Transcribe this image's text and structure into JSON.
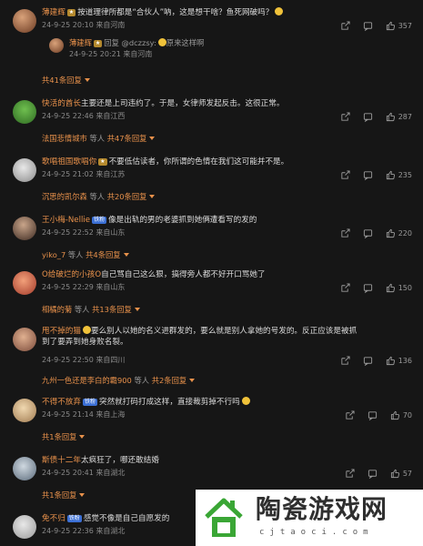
{
  "comments": [
    {
      "user": "薄建辉",
      "badge": "",
      "text": "按道理律所都是“合伙人”吶，这是想干啥？鱼死网破吗？",
      "time": "24-9-25 20:10",
      "location": "来自河南",
      "likes": "357",
      "reply": {
        "user": "薄建辉",
        "text": "回复 @dczzsy:",
        "text2": "原来这样啊",
        "time": "24-9-25 20:21",
        "location": "来自河南"
      },
      "more": "共41条回复"
    },
    {
      "user": "快活的酋长",
      "text": "主要还是上司违约了。于是，女律师发起反击。这很正常。",
      "time": "24-9-25 22:46",
      "location": "来自江西",
      "likes": "287",
      "sub_user": "法国悲情城市",
      "sub_mid": "等人",
      "more": "共47条回复"
    },
    {
      "user": "歌唱祖国歌唱你",
      "badge": "",
      "text": "不要低估读者，你所谓的色情在我们这可能并不是。",
      "time": "24-9-25 21:02",
      "location": "来自江苏",
      "likes": "235",
      "sub_user": "沉思的凯尔森",
      "sub_mid": "等人",
      "more": "共20条回复"
    },
    {
      "user": "王小梅-Nellie",
      "badge": "铁粉",
      "text": "像是出轨的男的老婆抓到她俩遭看写的发的",
      "time": "24-9-25 22:52",
      "location": "来自山东",
      "likes": "220",
      "sub_user": "yiko_7",
      "sub_mid": "等人",
      "more": "共4条回复"
    },
    {
      "user": "O给破烂的小孩O",
      "text": "自己骂自己这么狠，搞得旁人都不好开口骂她了",
      "time": "24-9-25 22:29",
      "location": "来自山东",
      "likes": "150",
      "sub_user": "相橘的菊",
      "sub_mid": "等人",
      "more": "共13条回复"
    },
    {
      "user": "甩不掉的猫",
      "text": "要么别人以她的名义进群发的，要么就是别人拿她的号发的。反正应该是被抓到了要弄到她身败名裂。",
      "time": "24-9-25 22:50",
      "location": "来自四川",
      "likes": "136",
      "sub_user": "九州一色还是李白的霸900",
      "sub_mid": "等人",
      "more": "共2条回复"
    },
    {
      "user": "不得不放弃",
      "badge": "铁粉",
      "text": "突然就打码打成这样，直接裁剪掉不行吗",
      "time": "24-9-25 21:14",
      "location": "来自上海",
      "likes": "70",
      "more": "共1条回复"
    },
    {
      "user": "斯债十二年",
      "text": "太疯狂了，哪还敢结婚",
      "time": "24-9-25 20:41",
      "location": "来自湖北",
      "likes": "57",
      "more": "共1条回复"
    },
    {
      "user": "免不归",
      "badge": "铁粉",
      "text": "感觉不像是自己自愿发的",
      "time": "24-9-25 22:36",
      "location": "来自湖北"
    }
  ],
  "watermark": {
    "title": "陶瓷游戏网",
    "url": "cjtaoci.com"
  },
  "colors": {
    "background": "#161616",
    "username": "#e8914b",
    "meta": "#8a8a8a"
  }
}
